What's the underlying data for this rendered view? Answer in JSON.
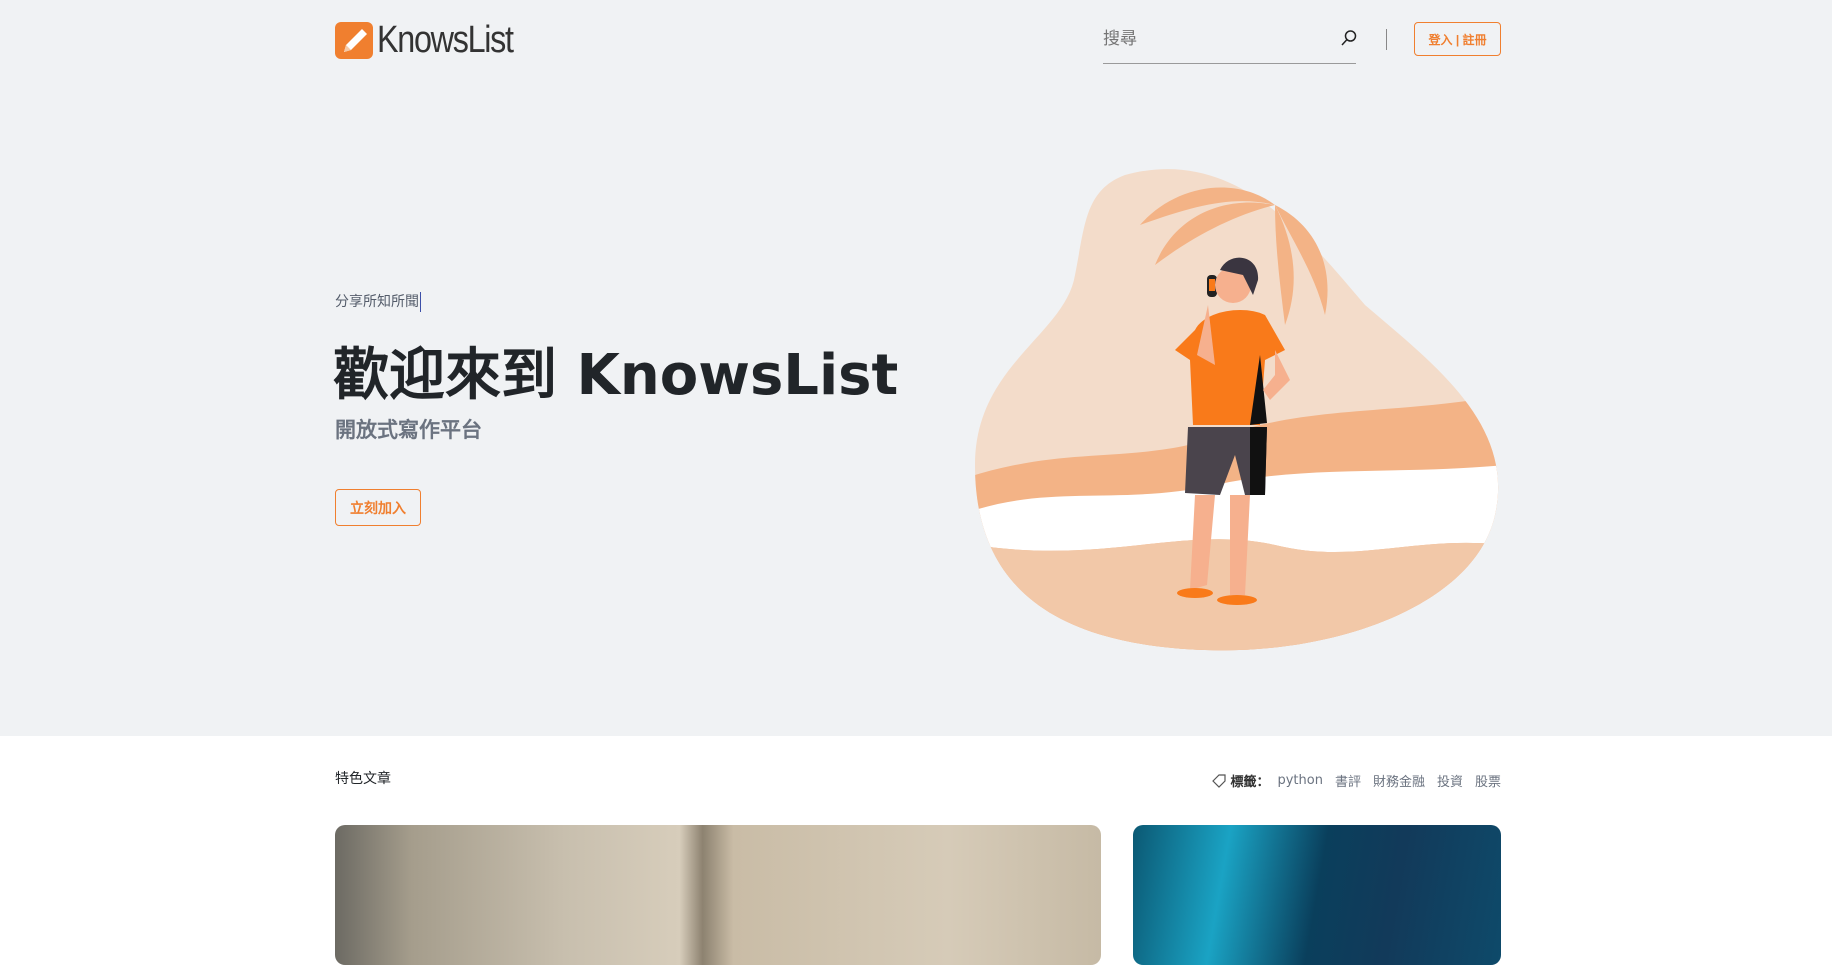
{
  "header": {
    "logo_text": "KnowsList",
    "search_placeholder": "搜尋",
    "login_label": "登入 | 註冊"
  },
  "hero": {
    "kicker": "分享所知所聞",
    "title": "歡迎來到 KnowsList",
    "subtitle": "開放式寫作平台",
    "cta_label": "立刻加入"
  },
  "featured": {
    "title": "特色文章",
    "tags_label": "標籤：",
    "tags": [
      "python",
      "書評",
      "財務金融",
      "投資",
      "股票"
    ]
  },
  "colors": {
    "accent": "#f07f2f",
    "hero_bg": "#f0f2f4"
  }
}
